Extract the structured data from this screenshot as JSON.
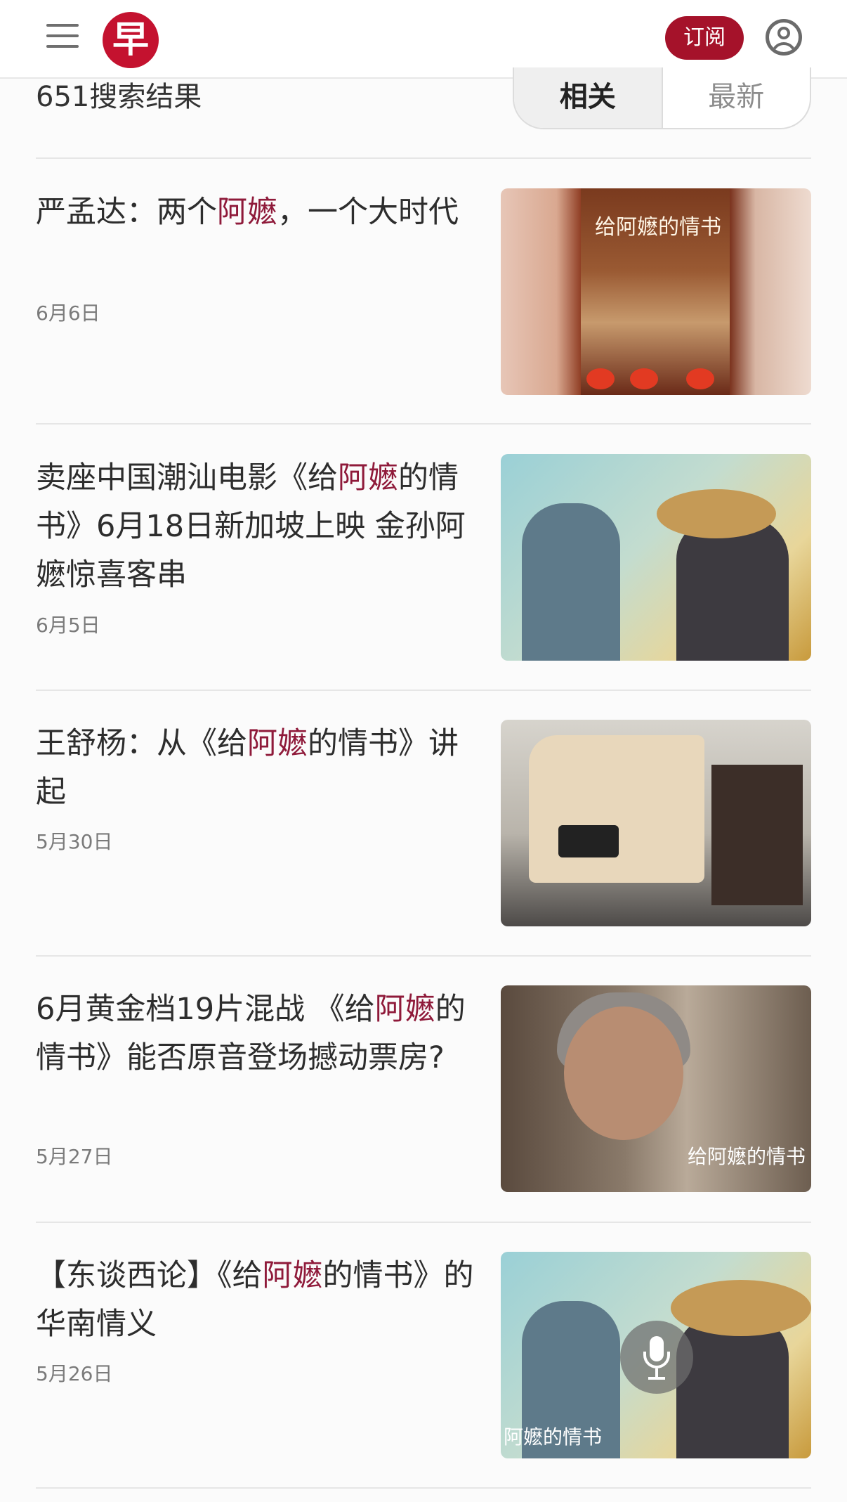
{
  "header": {
    "logo_text": "早",
    "subscribe_label": "订阅"
  },
  "search": {
    "results_count": "651搜索结果",
    "sort_tabs": [
      "相关",
      "最新"
    ],
    "active_tab": "相关"
  },
  "articles": [
    {
      "title_parts": [
        "严孟达：两个",
        "阿嬷",
        "，一个大时代"
      ],
      "date": "6月6日",
      "thumb_text": "给阿嬷的情书"
    },
    {
      "title_parts": [
        "卖座中国潮汕电影《给",
        "阿嬷",
        "的情书》6月18日新加坡上映 金孙阿嬷惊喜客串"
      ],
      "date": "6月5日"
    },
    {
      "title_parts": [
        "王舒杨：从《给",
        "阿嬷",
        "的情书》讲起"
      ],
      "date": "5月30日"
    },
    {
      "title_parts": [
        "6月黄金档19片混战 《给",
        "阿嬷",
        "的情书》能否原音登场撼动票房?"
      ],
      "date": "5月27日",
      "thumb_text": "给阿嬷的情书"
    },
    {
      "title_parts": [
        "【东谈西论】《给",
        "阿嬷",
        "的情书》的华南情义"
      ],
      "date": "5月26日",
      "thumb_text": "阿嬷的情书"
    }
  ],
  "colors": {
    "brand": "#c4122f",
    "subscribe": "#a5122a",
    "highlight": "#8f1a3a"
  },
  "icons": [
    "menu-icon",
    "account-icon",
    "microphone-icon"
  ]
}
